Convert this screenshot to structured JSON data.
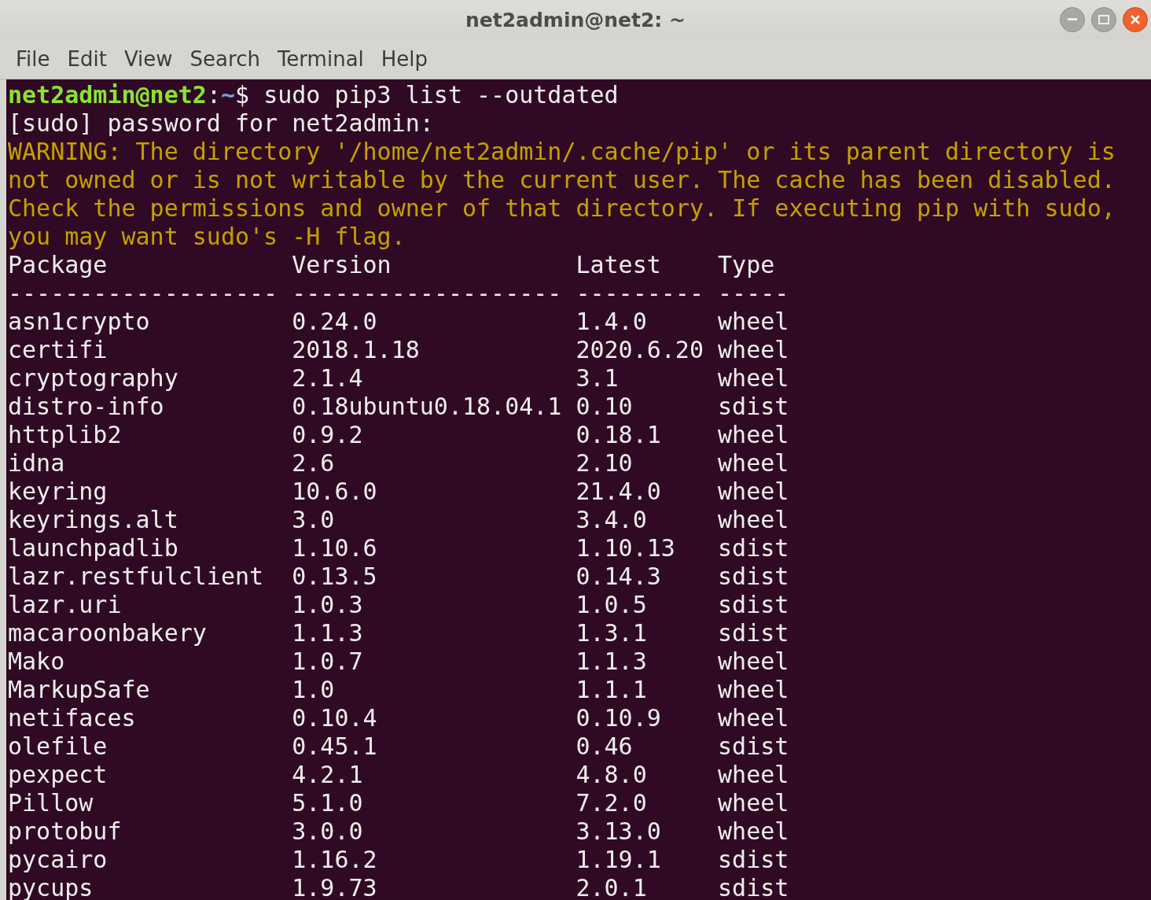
{
  "window": {
    "title": "net2admin@net2: ~"
  },
  "menu": [
    "File",
    "Edit",
    "View",
    "Search",
    "Terminal",
    "Help"
  ],
  "terminal": {
    "prompt": {
      "user_host": "net2admin@net2",
      "separator": ":",
      "path": "~",
      "symbol": "$",
      "command": "sudo pip3 list --outdated"
    },
    "lines": [
      {
        "kind": "plain",
        "text": "[sudo] password for net2admin:"
      },
      {
        "kind": "warning",
        "text": "WARNING: The directory '/home/net2admin/.cache/pip' or its parent directory is not owned or is not writable by the current user. The cache has been disabled. Check the permissions and owner of that directory. If executing pip with sudo, you may want sudo's -H flag."
      }
    ],
    "table": {
      "columns": [
        "Package",
        "Version",
        "Latest",
        "Type"
      ],
      "rules": [
        "-------------------",
        "-------------------",
        "---------",
        "-----"
      ],
      "rows": [
        [
          "asn1crypto",
          "0.24.0",
          "1.4.0",
          "wheel"
        ],
        [
          "certifi",
          "2018.1.18",
          "2020.6.20",
          "wheel"
        ],
        [
          "cryptography",
          "2.1.4",
          "3.1",
          "wheel"
        ],
        [
          "distro-info",
          "0.18ubuntu0.18.04.1",
          "0.10",
          "sdist"
        ],
        [
          "httplib2",
          "0.9.2",
          "0.18.1",
          "wheel"
        ],
        [
          "idna",
          "2.6",
          "2.10",
          "wheel"
        ],
        [
          "keyring",
          "10.6.0",
          "21.4.0",
          "wheel"
        ],
        [
          "keyrings.alt",
          "3.0",
          "3.4.0",
          "wheel"
        ],
        [
          "launchpadlib",
          "1.10.6",
          "1.10.13",
          "sdist"
        ],
        [
          "lazr.restfulclient",
          "0.13.5",
          "0.14.3",
          "sdist"
        ],
        [
          "lazr.uri",
          "1.0.3",
          "1.0.5",
          "sdist"
        ],
        [
          "macaroonbakery",
          "1.1.3",
          "1.3.1",
          "sdist"
        ],
        [
          "Mako",
          "1.0.7",
          "1.1.3",
          "wheel"
        ],
        [
          "MarkupSafe",
          "1.0",
          "1.1.1",
          "wheel"
        ],
        [
          "netifaces",
          "0.10.4",
          "0.10.9",
          "wheel"
        ],
        [
          "olefile",
          "0.45.1",
          "0.46",
          "sdist"
        ],
        [
          "pexpect",
          "4.2.1",
          "4.8.0",
          "wheel"
        ],
        [
          "Pillow",
          "5.1.0",
          "7.2.0",
          "wheel"
        ],
        [
          "protobuf",
          "3.0.0",
          "3.13.0",
          "wheel"
        ],
        [
          "pycairo",
          "1.16.2",
          "1.19.1",
          "sdist"
        ],
        [
          "pycups",
          "1.9.73",
          "2.0.1",
          "sdist"
        ]
      ]
    }
  }
}
